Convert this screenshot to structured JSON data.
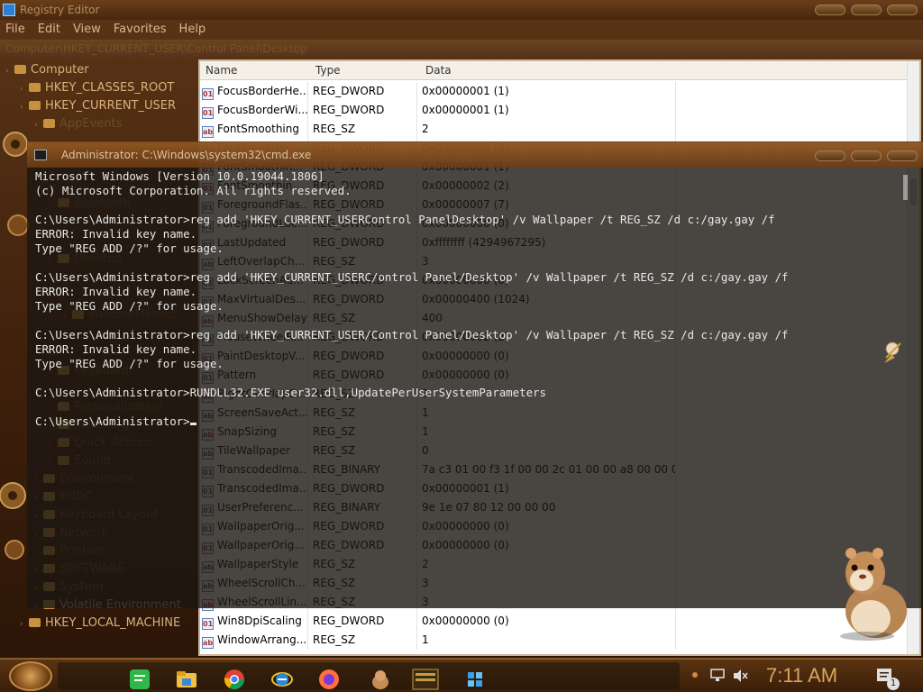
{
  "regedit": {
    "title": "Registry Editor",
    "menu": [
      "File",
      "Edit",
      "View",
      "Favorites",
      "Help"
    ],
    "address": "Computer\\HKEY_CURRENT_USER\\Control Panel\\Desktop",
    "tree": [
      {
        "label": "Computer",
        "level": 0,
        "dim": false
      },
      {
        "label": "HKEY_CLASSES_ROOT",
        "level": 1,
        "dim": false
      },
      {
        "label": "HKEY_CURRENT_USER",
        "level": 1,
        "dim": false
      },
      {
        "label": "AppEvents",
        "level": 2,
        "dim": true
      },
      {
        "label": "Bluetooth",
        "level": 3,
        "dim": true
      },
      {
        "label": "Desktop",
        "level": 3,
        "dim": true
      },
      {
        "label": "WindowMetrics",
        "level": 4,
        "dim": true
      },
      {
        "label": "Keyboard",
        "level": 3,
        "dim": true
      },
      {
        "label": "Personalization",
        "level": 3,
        "dim": true
      },
      {
        "label": "PowerCfg",
        "level": 3,
        "dim": true
      },
      {
        "label": "Quick Actions",
        "level": 3,
        "dim": true
      },
      {
        "label": "Sound",
        "level": 3,
        "dim": true
      },
      {
        "label": "Environment",
        "level": 2,
        "dim": true
      },
      {
        "label": "EUDC",
        "level": 2,
        "dim": true
      },
      {
        "label": "Keyboard Layout",
        "level": 2,
        "dim": true
      },
      {
        "label": "Network",
        "level": 2,
        "dim": true
      },
      {
        "label": "Printers",
        "level": 2,
        "dim": true
      },
      {
        "label": "SOFTWARE",
        "level": 2,
        "dim": true
      },
      {
        "label": "System",
        "level": 2,
        "dim": true
      },
      {
        "label": "Volatile Environment",
        "level": 2,
        "dim": false
      },
      {
        "label": "HKEY_LOCAL_MACHINE",
        "level": 1,
        "dim": false
      }
    ],
    "columns": {
      "name": "Name",
      "type": "Type",
      "data": "Data"
    },
    "values": [
      {
        "name": "FocusBorderHe...",
        "type": "REG_DWORD",
        "data": "0x00000001 (1)",
        "kind": "bin"
      },
      {
        "name": "FocusBorderWi...",
        "type": "REG_DWORD",
        "data": "0x00000001 (1)",
        "kind": "bin"
      },
      {
        "name": "FontSmoothing",
        "type": "REG_SZ",
        "data": "2",
        "kind": "sz"
      },
      {
        "name": "FontSmoothin...",
        "type": "REG_DWORD",
        "data": "0x00000000 (0)",
        "kind": "bin"
      },
      {
        "name": "FontSmoothin...",
        "type": "REG_DWORD",
        "data": "0x00000001 (1)",
        "kind": "bin"
      },
      {
        "name": "FontSmoothin...",
        "type": "REG_DWORD",
        "data": "0x00000002 (2)",
        "kind": "bin"
      },
      {
        "name": "ForegroundFlas...",
        "type": "REG_DWORD",
        "data": "0x00000007 (7)",
        "kind": "bin"
      },
      {
        "name": "ForegroundLoc...",
        "type": "REG_DWORD",
        "data": "0x00000000 (0)",
        "kind": "bin"
      },
      {
        "name": "LastUpdated",
        "type": "REG_DWORD",
        "data": "0xffffffff (4294967295)",
        "kind": "bin"
      },
      {
        "name": "LeftOverlapCh...",
        "type": "REG_SZ",
        "data": "3",
        "kind": "sz"
      },
      {
        "name": "LockScreenAu...",
        "type": "REG_DWORD",
        "data": "0x00000000 (0)",
        "kind": "bin"
      },
      {
        "name": "MaxVirtualDes...",
        "type": "REG_DWORD",
        "data": "0x00000400 (1024)",
        "kind": "bin"
      },
      {
        "name": "MenuShowDelay",
        "type": "REG_SZ",
        "data": "400",
        "kind": "sz"
      },
      {
        "name": "MouseWheelR...",
        "type": "REG_DWORD",
        "data": "0x00000002 (2)",
        "kind": "bin"
      },
      {
        "name": "PaintDesktopV...",
        "type": "REG_DWORD",
        "data": "0x00000000 (0)",
        "kind": "bin"
      },
      {
        "name": "Pattern",
        "type": "REG_DWORD",
        "data": "0x00000000 (0)",
        "kind": "bin"
      },
      {
        "name": "RightOverlapC...",
        "type": "REG_SZ",
        "data": "3",
        "kind": "sz"
      },
      {
        "name": "ScreenSaveAct...",
        "type": "REG_SZ",
        "data": "1",
        "kind": "sz"
      },
      {
        "name": "SnapSizing",
        "type": "REG_SZ",
        "data": "1",
        "kind": "sz"
      },
      {
        "name": "TileWallpaper",
        "type": "REG_SZ",
        "data": "0",
        "kind": "sz"
      },
      {
        "name": "TranscodedIma...",
        "type": "REG_BINARY",
        "data": "7a c3 01 00 f3 1f 00 00 2c 01 00 00 a8 00 00 0...",
        "kind": "bin"
      },
      {
        "name": "TranscodedIma...",
        "type": "REG_DWORD",
        "data": "0x00000001 (1)",
        "kind": "bin"
      },
      {
        "name": "UserPreferenc...",
        "type": "REG_BINARY",
        "data": "9e 1e 07 80 12 00 00 00",
        "kind": "bin"
      },
      {
        "name": "WallpaperOrig...",
        "type": "REG_DWORD",
        "data": "0x00000000 (0)",
        "kind": "bin"
      },
      {
        "name": "WallpaperOrig...",
        "type": "REG_DWORD",
        "data": "0x00000000 (0)",
        "kind": "bin"
      },
      {
        "name": "WallpaperStyle",
        "type": "REG_SZ",
        "data": "2",
        "kind": "sz"
      },
      {
        "name": "WheelScrollCh...",
        "type": "REG_SZ",
        "data": "3",
        "kind": "sz"
      },
      {
        "name": "WheelScrollLin...",
        "type": "REG_SZ",
        "data": "3",
        "kind": "sz"
      },
      {
        "name": "Win8DpiScaling",
        "type": "REG_DWORD",
        "data": "0x00000000 (0)",
        "kind": "bin"
      },
      {
        "name": "WindowArrang...",
        "type": "REG_SZ",
        "data": "1",
        "kind": "sz"
      }
    ]
  },
  "cmd": {
    "title": "Administrator: C:\\Windows\\system32\\cmd.exe",
    "lines": [
      "Microsoft Windows [Version 10.0.19044.1806]",
      "(c) Microsoft Corporation. All rights reserved.",
      "",
      "C:\\Users\\Administrator>reg add 'HKEY_CURRENT_USERControl PanelDesktop' /v Wallpaper /t REG_SZ /d c:/gay.gay /f",
      "ERROR: Invalid key name.",
      "Type \"REG ADD /?\" for usage.",
      "",
      "C:\\Users\\Administrator>reg add 'HKEY_CURRENT_USERC/ontrol Panel/Desktop' /v Wallpaper /t REG_SZ /d c:/gay.gay /f",
      "ERROR: Invalid key name.",
      "Type \"REG ADD /?\" for usage.",
      "",
      "C:\\Users\\Administrator>reg add 'HKEY_CURRENT_USER/Control Panel/Desktop' /v Wallpaper /t REG_SZ /d c:/gay.gay /f",
      "ERROR: Invalid key name.",
      "Type \"REG ADD /?\" for usage.",
      "",
      "C:\\Users\\Administrator>RUNDLL32.EXE user32.dll,UpdatePerUserSystemParameters",
      "",
      "C:\\Users\\Administrator>"
    ]
  },
  "taskbar": {
    "apps": [
      "notes-app",
      "file-explorer",
      "chrome",
      "ie-browser",
      "firefox",
      "hamster-app",
      "media-app",
      "cube-app"
    ],
    "clock": "7:11 AM",
    "notification_count": "1"
  }
}
